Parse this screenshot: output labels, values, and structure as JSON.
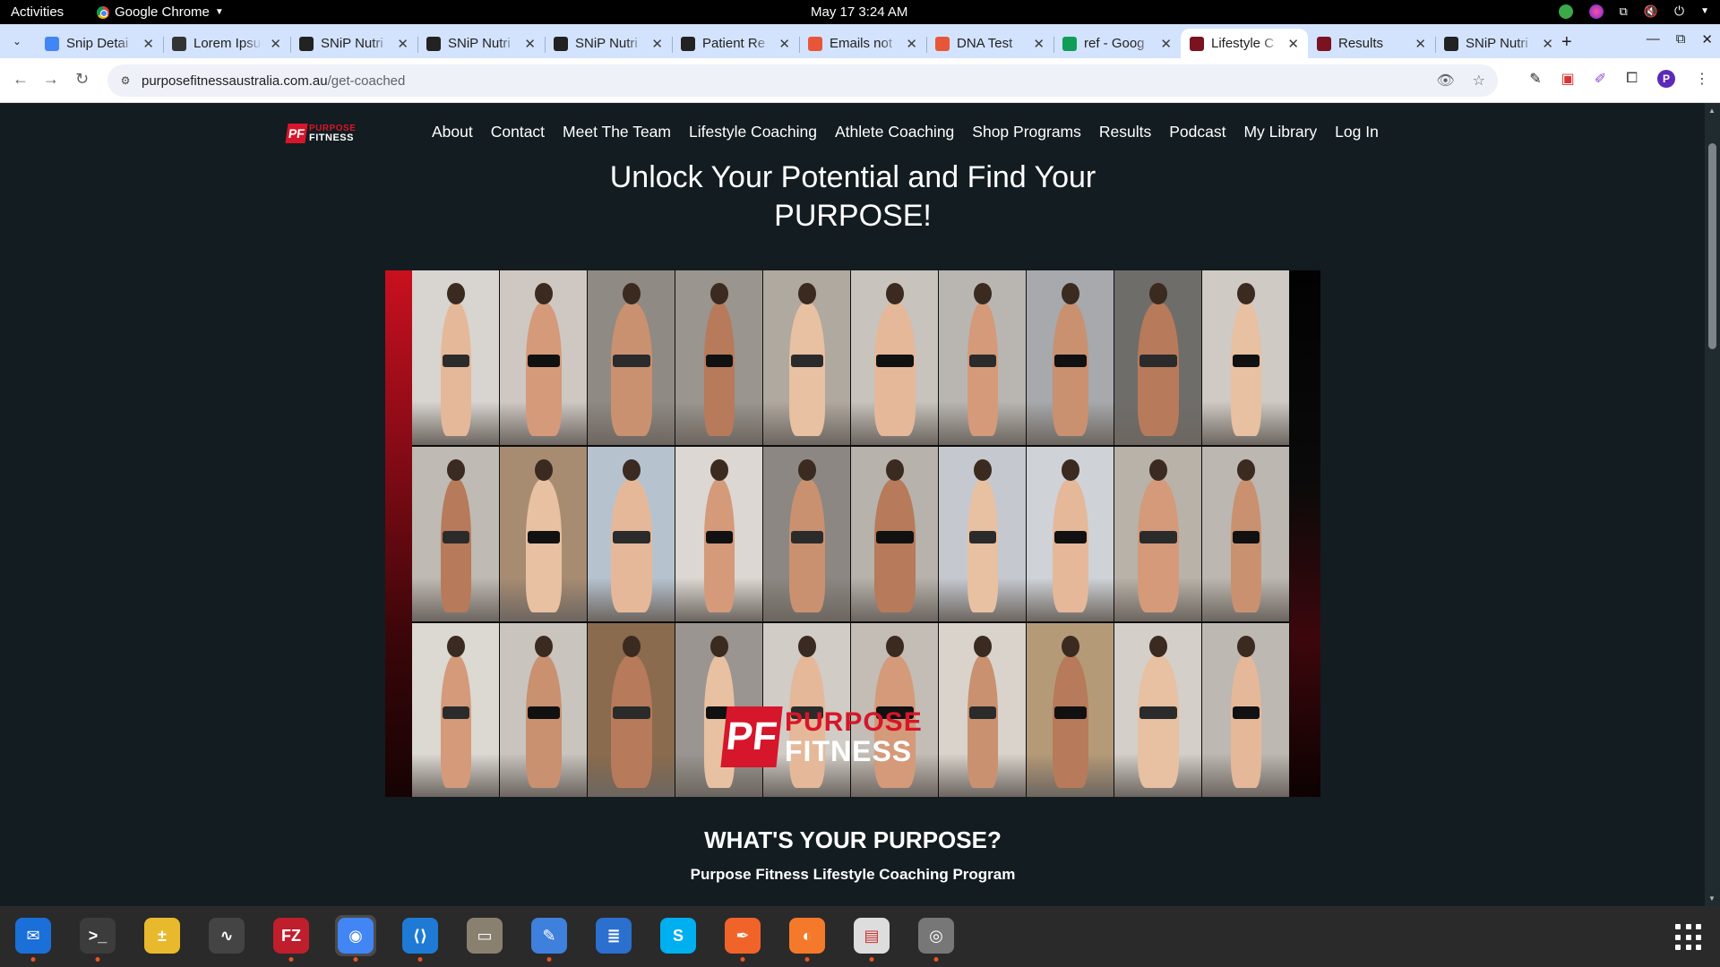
{
  "system_bar": {
    "activities": "Activities",
    "app_name": "Google Chrome",
    "clock": "May 17  3:24 AM"
  },
  "browser": {
    "tabs": [
      {
        "title": "Snip Detai",
        "favicon": "docs-icon",
        "color": "#4285f4"
      },
      {
        "title": "Lorem Ipsu",
        "favicon": "lipsum-icon",
        "color": "#333333"
      },
      {
        "title": "SNiP Nutri",
        "favicon": "snip-icon",
        "color": "#222222"
      },
      {
        "title": "SNiP Nutri",
        "favicon": "snip-icon",
        "color": "#222222"
      },
      {
        "title": "SNiP Nutri",
        "favicon": "snip-icon",
        "color": "#222222"
      },
      {
        "title": "Patient Re",
        "favicon": "snip-icon",
        "color": "#222222"
      },
      {
        "title": "Emails not",
        "favicon": "emails-icon",
        "color": "#e8563a"
      },
      {
        "title": "DNA Test",
        "favicon": "emails-icon",
        "color": "#e8563a"
      },
      {
        "title": "ref - Goog",
        "favicon": "sheets-icon",
        "color": "#0f9d58"
      },
      {
        "title": "Lifestyle C",
        "favicon": "purpose-icon",
        "color": "#7a1220",
        "active": true
      },
      {
        "title": "Results",
        "favicon": "purpose-icon",
        "color": "#7a1220"
      },
      {
        "title": "SNiP Nutri",
        "favicon": "snip-icon",
        "color": "#222222"
      }
    ],
    "url_host": "purposefitnessaustralia.com.au",
    "url_path": "/get-coached"
  },
  "site": {
    "logo_top": "PURPOSE",
    "logo_bottom": "FITNESS",
    "logo_mark": "PF",
    "nav": [
      "About",
      "Contact",
      "Meet The Team",
      "Lifestyle Coaching",
      "Athlete Coaching",
      "Shop Programs",
      "Results",
      "Podcast",
      "My Library",
      "Log In"
    ],
    "hero_line1": "Unlock Your Potential and Find Your",
    "hero_line2": "PURPOSE!",
    "section_title": "WHAT'S YOUR PURPOSE?",
    "section_subtitle": "Purpose Fitness Lifestyle Coaching Program",
    "collage_logo_top": "PURPOSE",
    "collage_logo_bottom": "FITNESS"
  },
  "dock": [
    {
      "name": "thunderbird-icon",
      "color": "#1a6fd8",
      "glyph": "✉"
    },
    {
      "name": "terminal-icon",
      "color": "#3c3c3c",
      "glyph": ">_"
    },
    {
      "name": "calculator-icon",
      "color": "#e8b92c",
      "glyph": "±"
    },
    {
      "name": "system-monitor-icon",
      "color": "#444444",
      "glyph": "∿"
    },
    {
      "name": "filezilla-icon",
      "color": "#bf1e2d",
      "glyph": "FZ"
    },
    {
      "name": "chrome-icon",
      "color": "#4285f4",
      "glyph": "◉"
    },
    {
      "name": "vscode-icon",
      "color": "#1e7ad4",
      "glyph": "⟨⟩"
    },
    {
      "name": "files-icon",
      "color": "#8a8070",
      "glyph": "▭"
    },
    {
      "name": "text-editor-icon",
      "color": "#3f80dc",
      "glyph": "✎"
    },
    {
      "name": "writer-icon",
      "color": "#2b6fcf",
      "glyph": "≣"
    },
    {
      "name": "skype-icon",
      "color": "#00aff0",
      "glyph": "S"
    },
    {
      "name": "inkscape-icon",
      "color": "#f0642a",
      "glyph": "✒"
    },
    {
      "name": "blender-icon",
      "color": "#f5792a",
      "glyph": "◐"
    },
    {
      "name": "document-viewer-icon",
      "color": "#dddddd",
      "glyph": "▤"
    },
    {
      "name": "disk-icon",
      "color": "#777777",
      "glyph": "◎"
    }
  ]
}
